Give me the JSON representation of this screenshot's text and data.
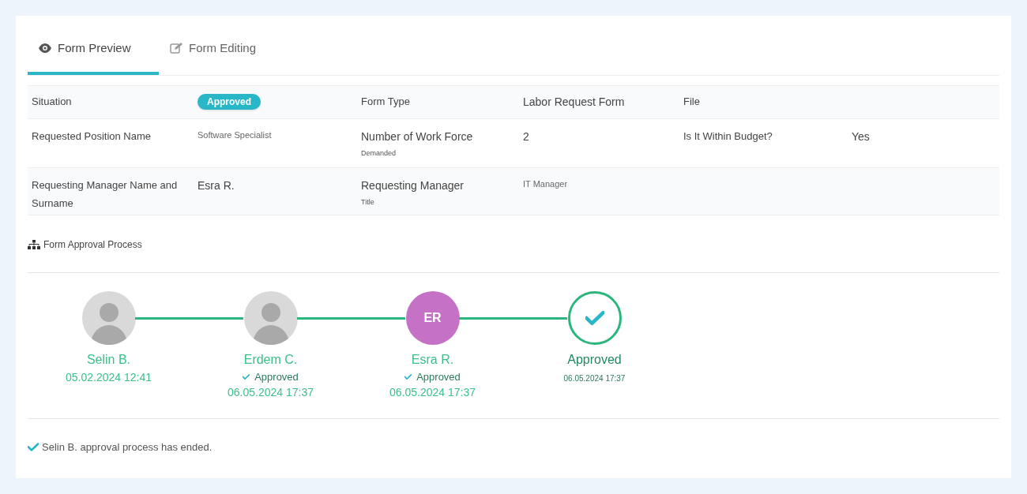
{
  "tabs": [
    {
      "label": "Form Preview",
      "selected": true
    },
    {
      "label": "Form Editing",
      "selected": false
    }
  ],
  "details": {
    "rows": [
      {
        "cells": [
          {
            "kind": "label",
            "text": "Situation"
          },
          {
            "kind": "badge",
            "text": "Approved"
          },
          {
            "kind": "label",
            "text": "Form Type"
          },
          {
            "kind": "value",
            "text": "Labor Request Form"
          },
          {
            "kind": "label",
            "text": "File"
          }
        ]
      },
      {
        "cells": [
          {
            "kind": "label",
            "text": "Requested Position Name"
          },
          {
            "kind": "small",
            "text": "Software Specialist"
          },
          {
            "kind": "value",
            "text": "Number of Work Force",
            "note": "Demanded"
          },
          {
            "kind": "value",
            "text": "2"
          },
          {
            "kind": "label",
            "text": "Is It Within Budget?"
          },
          {
            "kind": "value",
            "text": "Yes"
          }
        ]
      },
      {
        "cells": [
          {
            "kind": "label",
            "text": "Requesting Manager Name and",
            "note": "Surname"
          },
          {
            "kind": "value",
            "text": "Esra R."
          },
          {
            "kind": "value",
            "text": "Requesting Manager",
            "note": "Title"
          },
          {
            "kind": "small",
            "text": "IT Manager"
          }
        ]
      }
    ]
  },
  "approval": {
    "title": "Form Approval Process",
    "steps": [
      {
        "kind": "photo",
        "name": "Selin B.",
        "date": "05.02.2024 12:41"
      },
      {
        "kind": "photo",
        "name": "Erdem C.",
        "status": "Approved",
        "date": "06.05.2024 17:37"
      },
      {
        "kind": "initials",
        "initials": "ER",
        "color": "#c471c6",
        "name": "Esra R.",
        "status": "Approved",
        "date": "06.05.2024 17:37"
      },
      {
        "kind": "done",
        "name": "Approved",
        "date": "06.05.2024 17:37"
      }
    ]
  },
  "footer_message": "Selin B. approval process has ended."
}
